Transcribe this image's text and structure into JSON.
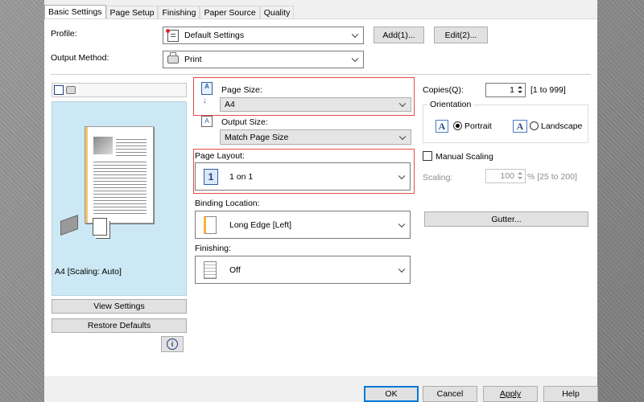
{
  "tabs": [
    "Basic Settings",
    "Page Setup",
    "Finishing",
    "Paper Source",
    "Quality"
  ],
  "profile": {
    "label": "Profile:",
    "value": "Default Settings",
    "add_label": "Add(1)...",
    "edit_label": "Edit(2)..."
  },
  "output_method": {
    "label": "Output Method:",
    "value": "Print"
  },
  "preview": {
    "caption": "A4 [Scaling: Auto]",
    "view_settings": "View Settings",
    "restore_defaults": "Restore Defaults"
  },
  "page_size": {
    "label": "Page Size:",
    "value": "A4"
  },
  "output_size": {
    "label": "Output Size:",
    "value": "Match Page Size"
  },
  "page_layout": {
    "label": "Page Layout:",
    "value": "1 on 1",
    "icon_number": "1"
  },
  "binding": {
    "label": "Binding Location:",
    "value": "Long Edge [Left]"
  },
  "finishing": {
    "label": "Finishing:",
    "value": "Off"
  },
  "copies": {
    "label": "Copies(Q):",
    "value": "1",
    "range": "[1 to 999]"
  },
  "orientation": {
    "label": "Orientation",
    "portrait": "Portrait",
    "landscape": "Landscape",
    "selected": "portrait",
    "icon_letter": "A"
  },
  "scaling": {
    "manual_label": "Manual Scaling",
    "label": "Scaling:",
    "value": "100",
    "range": "% [25 to 200]"
  },
  "gutter_label": "Gutter...",
  "footer": {
    "ok": "OK",
    "cancel": "Cancel",
    "apply": "Apply",
    "help": "Help"
  },
  "colors": {
    "highlight": "#e24b4b",
    "preview_bg": "#cce8f4",
    "accent": "#0078d7"
  }
}
